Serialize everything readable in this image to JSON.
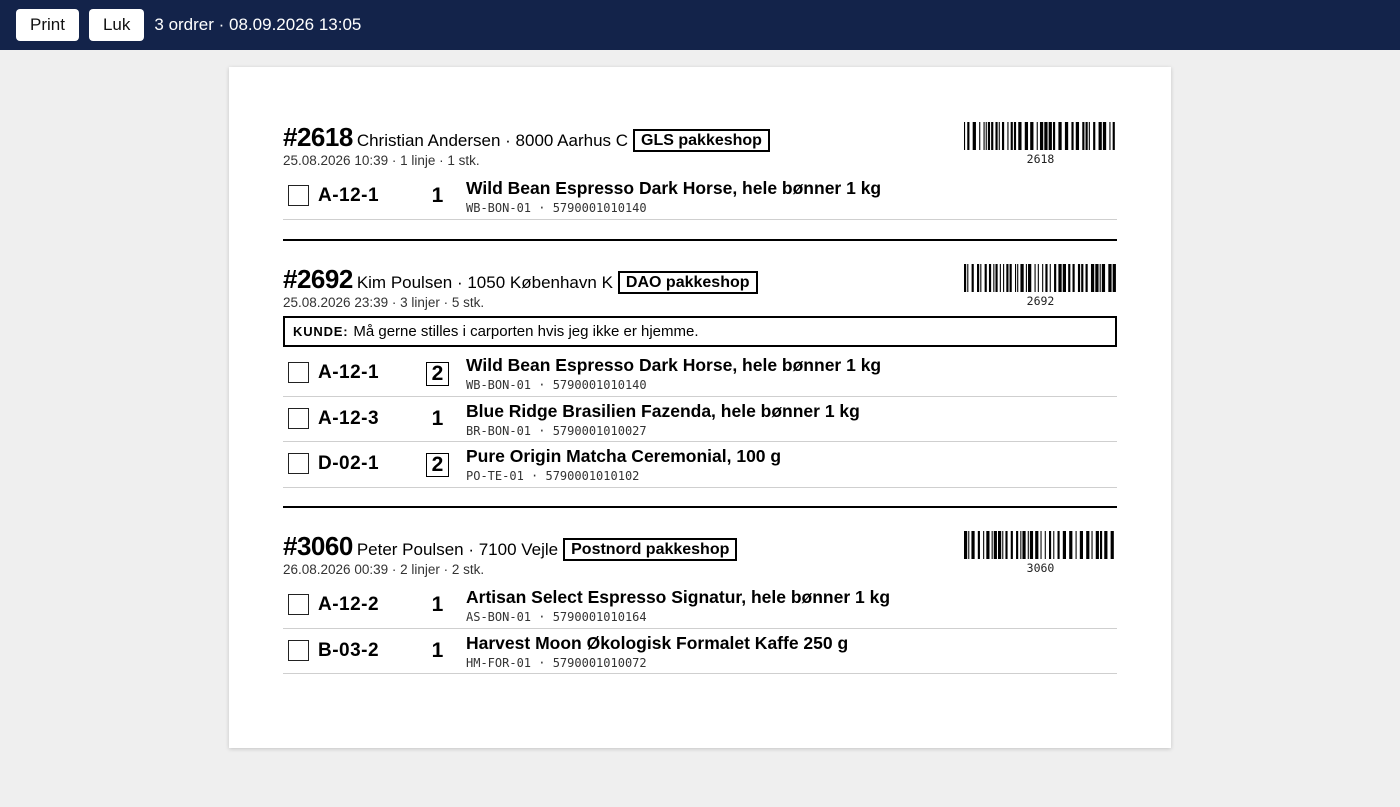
{
  "toolbar": {
    "print_label": "Print",
    "close_label": "Luk",
    "status": "3 ordrer · 08.09.2026 13:05"
  },
  "orders": [
    {
      "number": "#2618",
      "customer": "Christian Andersen · 8000 Aarhus C",
      "carrier": "GLS pakkeshop",
      "meta": "25.08.2026 10:39 · 1 linje · 1 stk.",
      "barcode": "2618",
      "lines": [
        {
          "location": "A-12-1",
          "qty": "1",
          "name": "Wild Bean Espresso Dark Horse, hele bønner 1 kg",
          "sku": "WB-BON-01  ·  5790001010140"
        }
      ]
    },
    {
      "number": "#2692",
      "customer": "Kim Poulsen · 1050 København K",
      "carrier": "DAO pakkeshop",
      "meta": "25.08.2026 23:39 · 3 linjer · 5 stk.",
      "barcode": "2692",
      "note_label": "KUNDE:",
      "note_text": "Må gerne stilles i carporten hvis jeg ikke er hjemme.",
      "lines": [
        {
          "location": "A-12-1",
          "qty": "2",
          "name": "Wild Bean Espresso Dark Horse, hele bønner 1 kg",
          "sku": "WB-BON-01  ·  5790001010140"
        },
        {
          "location": "A-12-3",
          "qty": "1",
          "name": "Blue Ridge Brasilien Fazenda, hele bønner 1 kg",
          "sku": "BR-BON-01  ·  5790001010027"
        },
        {
          "location": "D-02-1",
          "qty": "2",
          "name": "Pure Origin Matcha Ceremonial, 100 g",
          "sku": "PO-TE-01  ·  5790001010102"
        }
      ]
    },
    {
      "number": "#3060",
      "customer": "Peter Poulsen · 7100 Vejle",
      "carrier": "Postnord pakkeshop",
      "meta": "26.08.2026 00:39 · 2 linjer · 2 stk.",
      "barcode": "3060",
      "lines": [
        {
          "location": "A-12-2",
          "qty": "1",
          "name": "Artisan Select Espresso Signatur, hele bønner 1 kg",
          "sku": "AS-BON-01  ·  5790001010164"
        },
        {
          "location": "B-03-2",
          "qty": "1",
          "name": "Harvest Moon Økologisk Formalet Kaffe 250 g",
          "sku": "HM-FOR-01  ·  5790001010072"
        }
      ]
    }
  ]
}
